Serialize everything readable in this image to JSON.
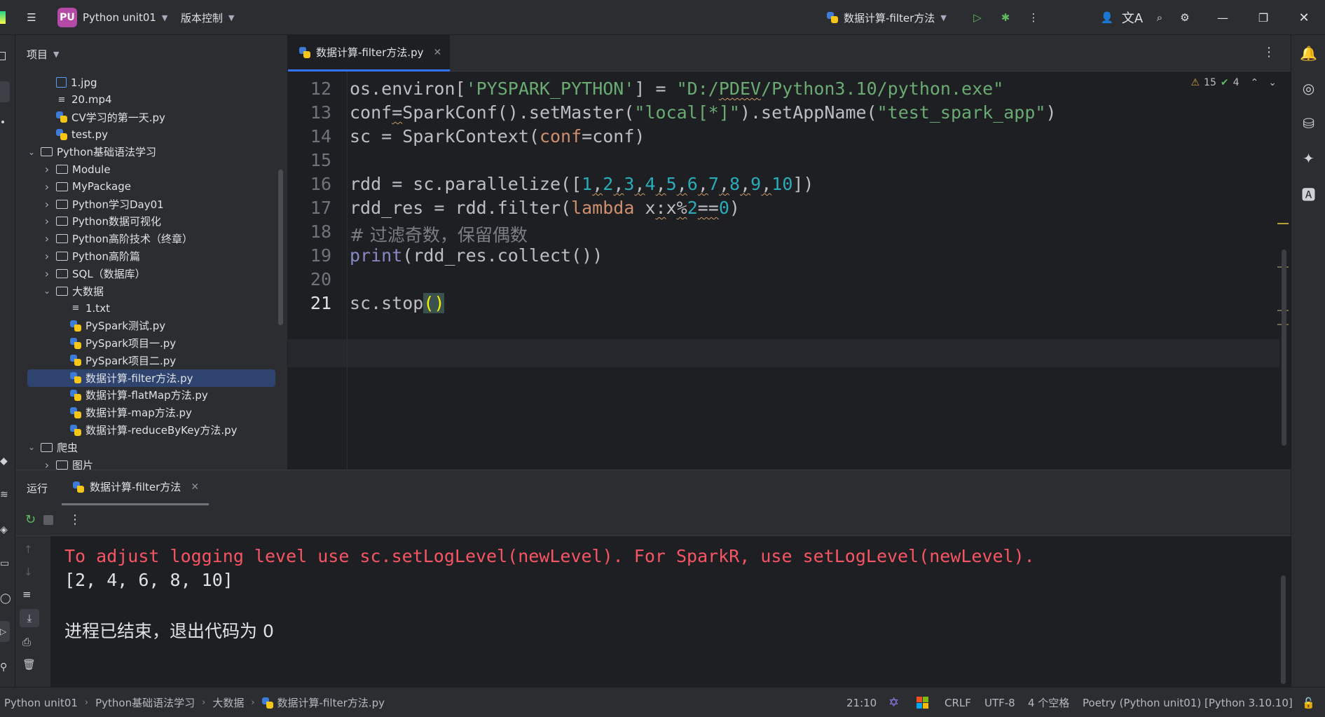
{
  "titlebar": {
    "project_badge": "PU",
    "project_name": "Python unit01",
    "vcs_label": "版本控制",
    "run_config": "数据计算-filter方法"
  },
  "project_panel": {
    "title": "项目",
    "tree": [
      {
        "label": "1.jpg",
        "type": "image",
        "indent": 2
      },
      {
        "label": "20.mp4",
        "type": "text",
        "indent": 2
      },
      {
        "label": "CV学习的第一天.py",
        "type": "python",
        "indent": 2
      },
      {
        "label": "test.py",
        "type": "python",
        "indent": 2
      },
      {
        "label": "Python基础语法学习",
        "type": "folder",
        "indent": 1,
        "expanded": true
      },
      {
        "label": "Module",
        "type": "package",
        "indent": 2,
        "expanded": false
      },
      {
        "label": "MyPackage",
        "type": "package",
        "indent": 2,
        "expanded": false
      },
      {
        "label": "Python学习Day01",
        "type": "folder",
        "indent": 2,
        "expanded": false
      },
      {
        "label": "Python数据可视化",
        "type": "folder",
        "indent": 2,
        "expanded": false
      },
      {
        "label": "Python高阶技术（终章）",
        "type": "folder",
        "indent": 2,
        "expanded": false
      },
      {
        "label": "Python高阶篇",
        "type": "folder",
        "indent": 2,
        "expanded": false
      },
      {
        "label": "SQL（数据库）",
        "type": "folder",
        "indent": 2,
        "expanded": false
      },
      {
        "label": "大数据",
        "type": "folder",
        "indent": 2,
        "expanded": true
      },
      {
        "label": "1.txt",
        "type": "text",
        "indent": 3
      },
      {
        "label": "PySpark测试.py",
        "type": "python",
        "indent": 3
      },
      {
        "label": "PySpark项目一.py",
        "type": "python",
        "indent": 3
      },
      {
        "label": "PySpark项目二.py",
        "type": "python",
        "indent": 3
      },
      {
        "label": "数据计算-filter方法.py",
        "type": "python",
        "indent": 3,
        "selected": true
      },
      {
        "label": "数据计算-flatMap方法.py",
        "type": "python",
        "indent": 3
      },
      {
        "label": "数据计算-map方法.py",
        "type": "python",
        "indent": 3
      },
      {
        "label": "数据计算-reduceByKey方法.py",
        "type": "python",
        "indent": 3
      },
      {
        "label": "爬虫",
        "type": "folder",
        "indent": 1,
        "expanded": true
      },
      {
        "label": "图片",
        "type": "folder",
        "indent": 2,
        "expanded": false
      }
    ]
  },
  "editor": {
    "tab_label": "数据计算-filter方法.py",
    "warnings_count": "15",
    "typos_count": "4",
    "line_numbers": [
      "12",
      "13",
      "14",
      "15",
      "16",
      "17",
      "18",
      "19",
      "20",
      "21"
    ],
    "current_line": "21"
  },
  "run_panel": {
    "title": "运行",
    "tab_label": "数据计算-filter方法",
    "output": [
      {
        "text": "To adjust logging level use sc.setLogLevel(newLevel). For SparkR, use setLogLevel(newLevel).",
        "kind": "error"
      },
      {
        "text": "[2, 4, 6, 8, 10]",
        "kind": "normal"
      },
      {
        "text": "",
        "kind": "normal"
      },
      {
        "text": "进程已结束，退出代码为 0",
        "kind": "normal"
      }
    ]
  },
  "statusbar": {
    "breadcrumb": [
      "Python unit01",
      "Python基础语法学习",
      "大数据",
      "数据计算-filter方法.py"
    ],
    "position": "21:10",
    "line_ending": "CRLF",
    "encoding": "UTF-8",
    "indent": "4 个空格",
    "interpreter": "Poetry (Python unit01) [Python 3.10.10]"
  },
  "colors": {
    "accent": "#3574f0",
    "error_text": "#f75464",
    "string": "#6aab73",
    "number": "#2aacb8",
    "keyword": "#cf8e6d"
  }
}
